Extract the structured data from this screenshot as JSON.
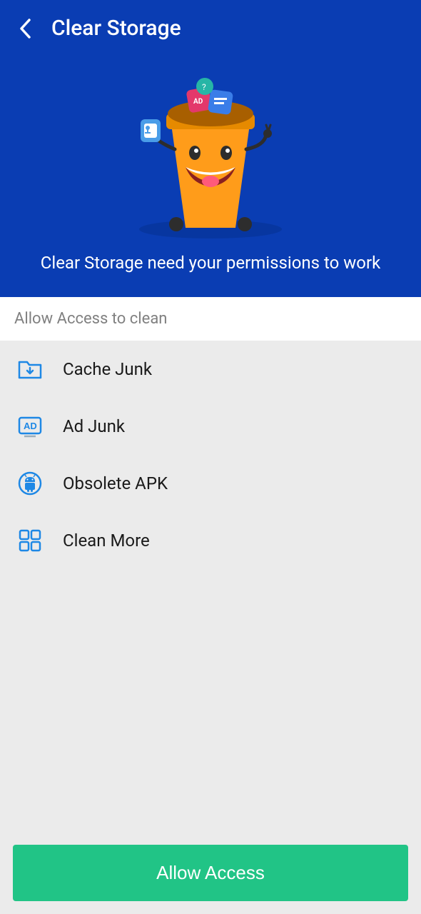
{
  "header": {
    "title": "Clear Storage",
    "permission_message": "Clear Storage need your permissions to work"
  },
  "section": {
    "label": "Allow Access to clean"
  },
  "items": [
    {
      "label": "Cache Junk",
      "icon": "folder-download"
    },
    {
      "label": "Ad Junk",
      "icon": "ad-badge"
    },
    {
      "label": "Obsolete APK",
      "icon": "android-circle"
    },
    {
      "label": "Clean More",
      "icon": "grid-squares"
    }
  ],
  "button": {
    "label": "Allow Access"
  }
}
